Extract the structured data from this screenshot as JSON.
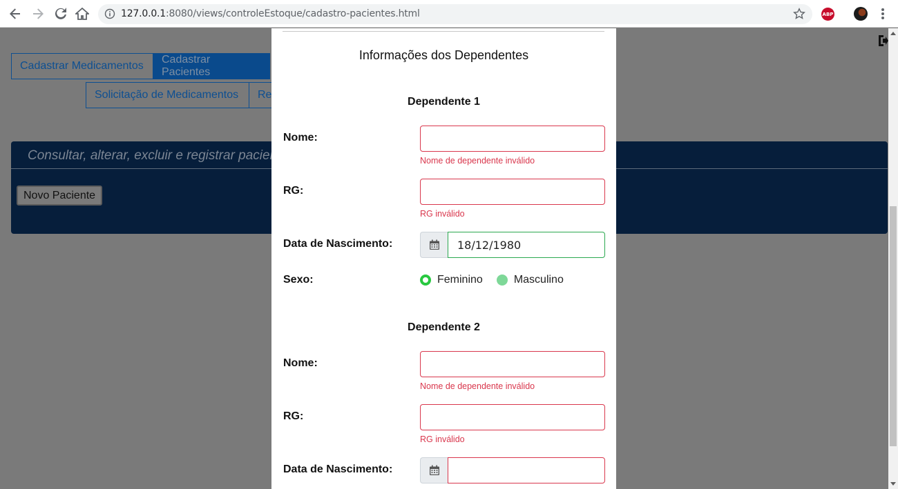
{
  "browser": {
    "url_host": "127.0.0.1",
    "url_rest": ":8080/views/controleEstoque/cadastro-pacientes.html",
    "abp_label": "ABP"
  },
  "page": {
    "tabs": [
      "Cadastrar Medicamentos",
      "Cadastrar Pacientes",
      "Solicitação de Medicamentos",
      "Rec"
    ],
    "panel_title": "Consultar, alterar, excluir e registrar pacien",
    "new_button": "Novo Paciente"
  },
  "modal": {
    "section_title": "Informações dos Dependentes",
    "dependents": [
      {
        "title": "Dependente 1",
        "name_label": "Nome:",
        "name_value": "",
        "name_error": "Nome de dependente inválido",
        "rg_label": "RG:",
        "rg_value": "",
        "rg_error": "RG inválido",
        "birth_label": "Data de Nascimento:",
        "birth_value": "18/12/1980",
        "sex_label": "Sexo:",
        "sex_options": [
          "Feminino",
          "Masculino"
        ],
        "sex_selected": "Feminino"
      },
      {
        "title": "Dependente 2",
        "name_label": "Nome:",
        "name_value": "",
        "name_error": "Nome de dependente inválido",
        "rg_label": "RG:",
        "rg_value": "",
        "rg_error": "RG inválido",
        "birth_label": "Data de Nascimento:",
        "birth_value": ""
      }
    ]
  },
  "colors": {
    "invalid": "#d9364c",
    "valid": "#2aa84f",
    "panel_bg": "#061e3b",
    "overlay": "#7a7a7a"
  }
}
